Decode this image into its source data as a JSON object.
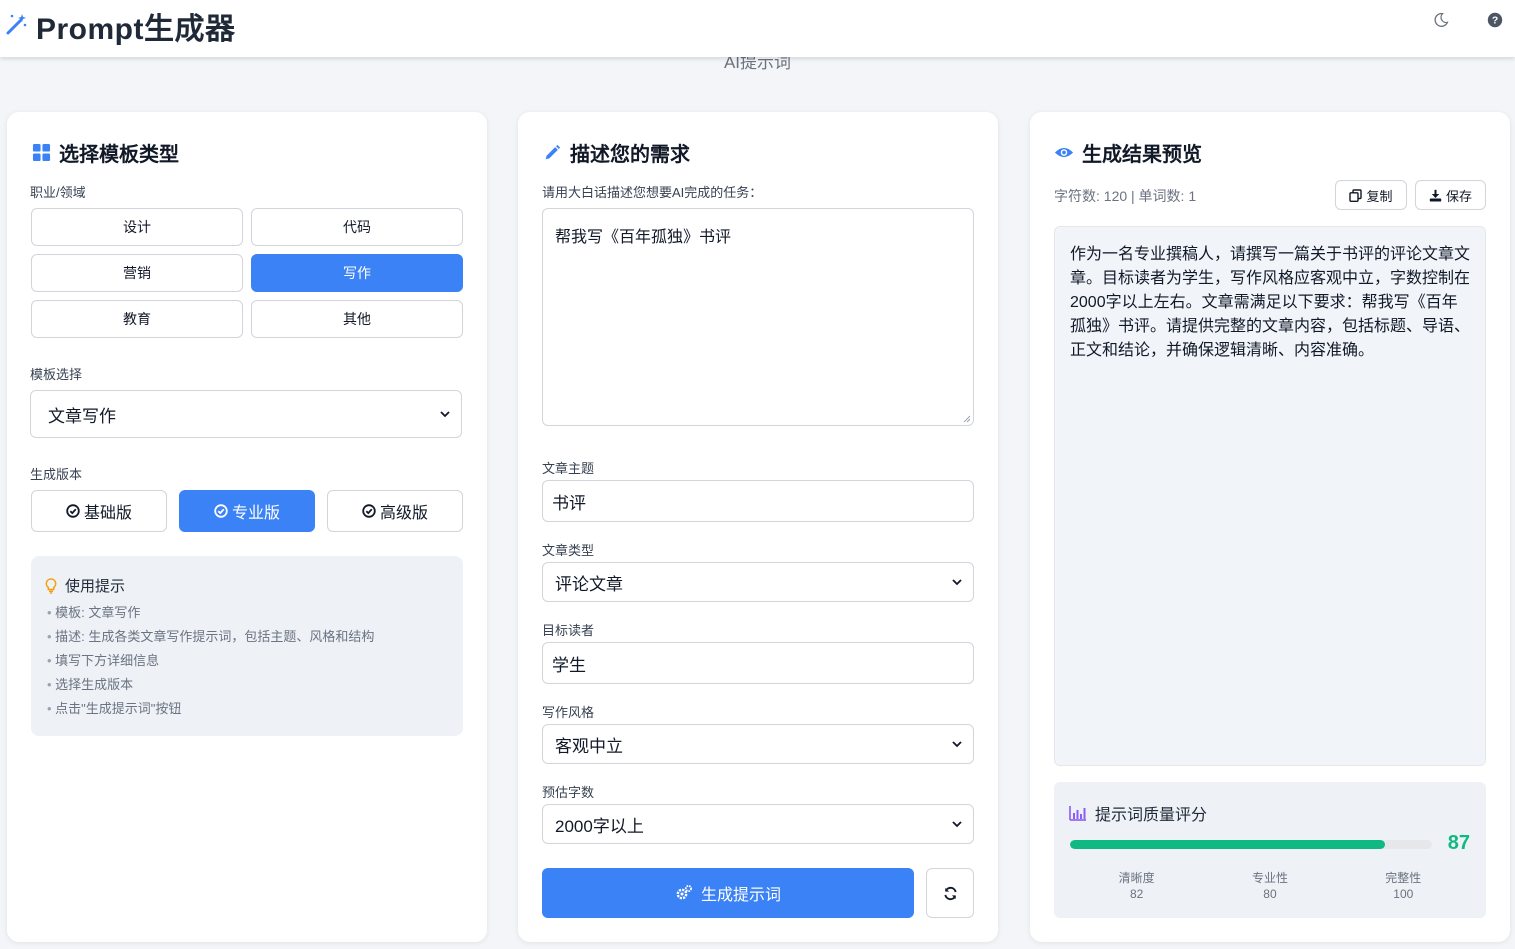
{
  "header": {
    "title": "Prompt生成器",
    "subtitle": "AI提示词"
  },
  "icons": {
    "logo": "magic-wand-icon",
    "theme": "moon-icon",
    "help": "question-circle-icon"
  },
  "colors": {
    "accent": "#3b82f6",
    "success": "#10b981"
  },
  "template_panel": {
    "title": "选择模板类型",
    "domain_label": "职业/领域",
    "domains": [
      {
        "label": "设计",
        "active": false
      },
      {
        "label": "代码",
        "active": false
      },
      {
        "label": "营销",
        "active": false
      },
      {
        "label": "写作",
        "active": true
      },
      {
        "label": "教育",
        "active": false
      },
      {
        "label": "其他",
        "active": false
      }
    ],
    "template_label": "模板选择",
    "template_value": "文章写作",
    "version_label": "生成版本",
    "versions": [
      {
        "label": "基础版",
        "active": false
      },
      {
        "label": "专业版",
        "active": true
      },
      {
        "label": "高级版",
        "active": false
      }
    ],
    "tips_title": "使用提示",
    "tips": [
      "模板: 文章写作",
      "描述: 生成各类文章写作提示词，包括主题、风格和结构",
      "填写下方详细信息",
      "选择生成版本",
      "点击\"生成提示词\"按钮"
    ]
  },
  "describe_panel": {
    "title": "描述您的需求",
    "task_label": "请用大白话描述您想要AI完成的任务：",
    "task_value": "帮我写《百年孤独》书评",
    "topic_label": "文章主题",
    "topic_value": "书评",
    "type_label": "文章类型",
    "type_value": "评论文章",
    "reader_label": "目标读者",
    "reader_value": "学生",
    "style_label": "写作风格",
    "style_value": "客观中立",
    "length_label": "预估字数",
    "length_value": "2000字以上",
    "generate_label": "生成提示词"
  },
  "result_panel": {
    "title": "生成结果预览",
    "stats": "字符数: 120 | 单词数: 1",
    "copy_label": "复制",
    "save_label": "保存",
    "preview_text": "作为一名专业撰稿人，请撰写一篇关于书评的评论文章文章。目标读者为学生，写作风格应客观中立，字数控制在2000字以上左右。文章需满足以下要求：帮我写《百年孤独》书评。请提供完整的文章内容，包括标题、导语、正文和结论，并确保逻辑清晰、内容准确。",
    "quality_title": "提示词质量评分",
    "quality_score": 87,
    "metrics": [
      {
        "label": "清晰度",
        "value": 82
      },
      {
        "label": "专业性",
        "value": 80
      },
      {
        "label": "完整性",
        "value": 100
      }
    ]
  }
}
